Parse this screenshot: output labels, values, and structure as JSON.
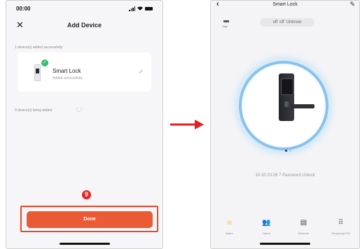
{
  "left_screen": {
    "status_bar": {
      "time": "00:00"
    },
    "nav": {
      "close_icon": "close-icon",
      "title": "Add Device"
    },
    "added_text": "1 device(s) added successfully",
    "device_card": {
      "name": "Smart Lock",
      "status": "Added successfully"
    },
    "adding_text": "0 device(s) being added",
    "step_number": "9",
    "done_label": "Done"
  },
  "right_screen": {
    "nav": {
      "title": "Smart Lock"
    },
    "battery_label": "High",
    "status_pills": [
      "off",
      "off",
      "Unknow"
    ],
    "record_text": "10-30 20:26  7 Password Unlock",
    "tabs": [
      {
        "label": "Alarm",
        "icon": "bell-icon"
      },
      {
        "label": "Users",
        "icon": "users-icon"
      },
      {
        "label": "Records",
        "icon": "calendar-icon"
      },
      {
        "label": "Temporary PW",
        "icon": "keypad-icon"
      }
    ]
  },
  "colors": {
    "accent_orange": "#ea5a34",
    "highlight_red": "#e8472a",
    "success_green": "#2fbe6c",
    "ring_blue": "#88c2ec",
    "alarm_yellow": "#e9b22a"
  }
}
